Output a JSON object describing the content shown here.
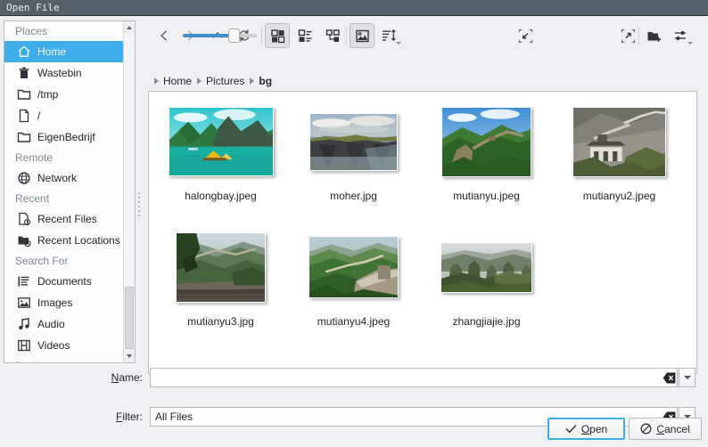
{
  "window": {
    "title": "Open File"
  },
  "sidebar": {
    "groups": [
      {
        "label": "Places",
        "items": [
          {
            "label": "Home",
            "icon": "home-icon",
            "selected": true
          },
          {
            "label": "Wastebin",
            "icon": "trash-icon",
            "selected": false
          },
          {
            "label": "/tmp",
            "icon": "folder-icon",
            "selected": false
          },
          {
            "label": "/",
            "icon": "file-icon",
            "selected": false
          },
          {
            "label": "EigenBedrijf",
            "icon": "folder-icon",
            "selected": false
          }
        ]
      },
      {
        "label": "Remote",
        "items": [
          {
            "label": "Network",
            "icon": "network-icon",
            "selected": false
          }
        ]
      },
      {
        "label": "Recent",
        "items": [
          {
            "label": "Recent Files",
            "icon": "recent-file-icon",
            "selected": false
          },
          {
            "label": "Recent Locations",
            "icon": "recent-folder-icon",
            "selected": false
          }
        ]
      },
      {
        "label": "Search For",
        "items": [
          {
            "label": "Documents",
            "icon": "document-icon",
            "selected": false
          },
          {
            "label": "Images",
            "icon": "image-icon",
            "selected": false
          },
          {
            "label": "Audio",
            "icon": "audio-icon",
            "selected": false
          },
          {
            "label": "Videos",
            "icon": "video-icon",
            "selected": false
          }
        ]
      },
      {
        "label": "Devices",
        "items": []
      }
    ]
  },
  "toolbar": {
    "buttons": [
      {
        "name": "back-button",
        "tooltip": "Back",
        "pressed": false
      },
      {
        "name": "forward-button",
        "tooltip": "Forward",
        "pressed": false
      },
      {
        "name": "up-button",
        "tooltip": "Up",
        "pressed": false
      },
      {
        "name": "reload-button",
        "tooltip": "Reload",
        "pressed": false
      },
      {
        "name": "icons-view-button",
        "tooltip": "Icons View",
        "pressed": true
      },
      {
        "name": "compact-view-button",
        "tooltip": "Compact View",
        "pressed": false
      },
      {
        "name": "detailed-view-button",
        "tooltip": "Detailed View",
        "pressed": false
      },
      {
        "name": "preview-button",
        "tooltip": "Preview",
        "pressed": true
      },
      {
        "name": "sort-button",
        "tooltip": "Sort",
        "pressed": false
      },
      {
        "name": "zoom-out-button",
        "tooltip": "Zoom Out",
        "pressed": false
      },
      {
        "name": "zoom-in-button",
        "tooltip": "Zoom In",
        "pressed": false
      },
      {
        "name": "new-folder-button",
        "tooltip": "New Folder",
        "pressed": false
      },
      {
        "name": "options-button",
        "tooltip": "Options",
        "pressed": false
      }
    ],
    "zoom_slider": {
      "value": 68,
      "min": 0,
      "max": 100,
      "accent_color": "#3b8ed0"
    }
  },
  "breadcrumb": {
    "crumbs": [
      {
        "label": "Home",
        "current": false
      },
      {
        "label": "Pictures",
        "current": false
      },
      {
        "label": "bg",
        "current": true
      }
    ]
  },
  "files": [
    {
      "name": "halongbay.jpeg",
      "thumb": "halongbay",
      "w": 118,
      "h": 78
    },
    {
      "name": "moher.jpg",
      "thumb": "moher",
      "w": 99,
      "h": 65
    },
    {
      "name": "mutianyu.jpeg",
      "thumb": "mutianyu",
      "w": 101,
      "h": 79
    },
    {
      "name": "mutianyu2.jpeg",
      "thumb": "mutianyu2",
      "w": 105,
      "h": 79
    },
    {
      "name": "mutianyu3.jpg",
      "thumb": "mutianyu3",
      "w": 101,
      "h": 79
    },
    {
      "name": "mutianyu4.jpeg",
      "thumb": "mutianyu4",
      "w": 101,
      "h": 70
    },
    {
      "name": "zhangjiajie.jpg",
      "thumb": "zhangjiajie",
      "w": 103,
      "h": 57
    }
  ],
  "fields": {
    "name": {
      "label_prefix": "",
      "label_accel": "N",
      "label_suffix": "ame:",
      "value": "",
      "placeholder": ""
    },
    "filter": {
      "label_prefix": "",
      "label_accel": "F",
      "label_suffix": "ilter:",
      "value": "All Files",
      "placeholder": ""
    }
  },
  "buttons": {
    "open": {
      "prefix": "",
      "accel": "O",
      "suffix": "pen",
      "icon": "check-icon",
      "focused": true
    },
    "cancel": {
      "prefix": "",
      "accel": "C",
      "suffix": "ancel",
      "icon": "cancel-icon",
      "focused": false
    }
  },
  "colors": {
    "titlebar": "#55616a",
    "selection": "#3daee9",
    "background": "#eff0f1",
    "view_background": "#ffffff"
  }
}
